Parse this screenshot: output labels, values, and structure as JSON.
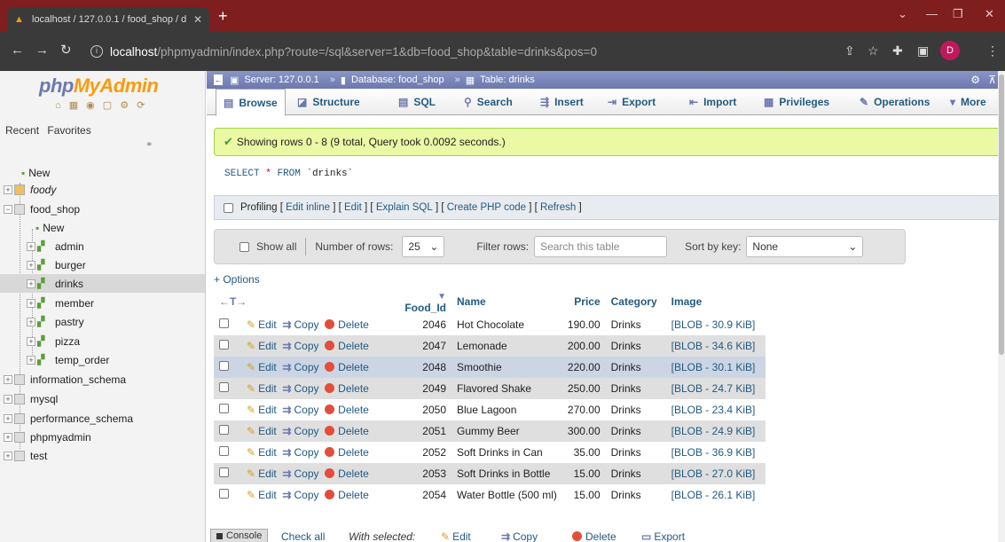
{
  "browser": {
    "tab_title": "localhost / 127.0.0.1 / food_shop / d",
    "url_host": "localhost",
    "url_rest": "/phpmyadmin/index.php?route=/sql&server=1&db=food_shop&table=drinks&pos=0",
    "profile_initial": "D"
  },
  "nav": {
    "logo_php": "php",
    "logo_myadmin": "MyAdmin",
    "recent": "Recent",
    "favorites": "Favorites",
    "tree": [
      {
        "label": "New"
      },
      {
        "label": "foody"
      },
      {
        "label": "food_shop"
      },
      {
        "label": "New"
      },
      {
        "label": "admin"
      },
      {
        "label": "burger"
      },
      {
        "label": "drinks"
      },
      {
        "label": "member"
      },
      {
        "label": "pastry"
      },
      {
        "label": "pizza"
      },
      {
        "label": "temp_order"
      },
      {
        "label": "information_schema"
      },
      {
        "label": "mysql"
      },
      {
        "label": "performance_schema"
      },
      {
        "label": "phpmyadmin"
      },
      {
        "label": "test"
      }
    ]
  },
  "breadcrumb": {
    "server": "Server: 127.0.0.1",
    "database": "Database: food_shop",
    "table": "Table: drinks"
  },
  "menu": {
    "browse": "Browse",
    "structure": "Structure",
    "sql": "SQL",
    "search": "Search",
    "insert": "Insert",
    "export": "Export",
    "import": "Import",
    "privileges": "Privileges",
    "operations": "Operations",
    "more": "More"
  },
  "message": "Showing rows 0 - 8 (9 total, Query took 0.0092 seconds.)",
  "sql": {
    "select": "SELECT",
    "star": "*",
    "from": "FROM",
    "table": "`drinks`"
  },
  "profiling": {
    "label": "Profiling",
    "edit_inline": "Edit inline",
    "edit": "Edit",
    "explain": "Explain SQL",
    "create_php": "Create PHP code",
    "refresh": "Refresh"
  },
  "navbar": {
    "show_all": "Show all",
    "num_rows_label": "Number of rows:",
    "num_rows": "25",
    "filter_label": "Filter rows:",
    "filter_placeholder": "Search this table",
    "sort_label": "Sort by key:",
    "sort_value": "None"
  },
  "options_link": "+ Options",
  "table": {
    "columns": [
      "Food_Id",
      "Name",
      "Price",
      "Category",
      "Image"
    ],
    "edit": "Edit",
    "copy": "Copy",
    "delete": "Delete",
    "rows": [
      [
        "2046",
        "Hot Chocolate",
        "190.00",
        "Drinks",
        "[BLOB - 30.9 KiB]"
      ],
      [
        "2047",
        "Lemonade",
        "200.00",
        "Drinks",
        "[BLOB - 34.6 KiB]"
      ],
      [
        "2048",
        "Smoothie",
        "220.00",
        "Drinks",
        "[BLOB - 30.1 KiB]"
      ],
      [
        "2049",
        "Flavored Shake",
        "250.00",
        "Drinks",
        "[BLOB - 24.7 KiB]"
      ],
      [
        "2050",
        "Blue Lagoon",
        "270.00",
        "Drinks",
        "[BLOB - 23.4 KiB]"
      ],
      [
        "2051",
        "Gummy Beer",
        "300.00",
        "Drinks",
        "[BLOB - 24.9 KiB]"
      ],
      [
        "2052",
        "Soft Drinks in Can",
        "35.00",
        "Drinks",
        "[BLOB - 36.9 KiB]"
      ],
      [
        "2053",
        "Soft Drinks in Bottle",
        "15.00",
        "Drinks",
        "[BLOB - 27.0 KiB]"
      ],
      [
        "2054",
        "Water Bottle (500 ml)",
        "15.00",
        "Drinks",
        "[BLOB - 26.1 KiB]"
      ]
    ]
  },
  "footer": {
    "console": "Console",
    "check_all": "Check all",
    "with_selected": "With selected:",
    "edit": "Edit",
    "copy": "Copy",
    "delete": "Delete",
    "export": "Export"
  },
  "colors": {
    "accent": "#6c78af",
    "link": "#235a81",
    "success_bg": "#ebf8a4"
  }
}
